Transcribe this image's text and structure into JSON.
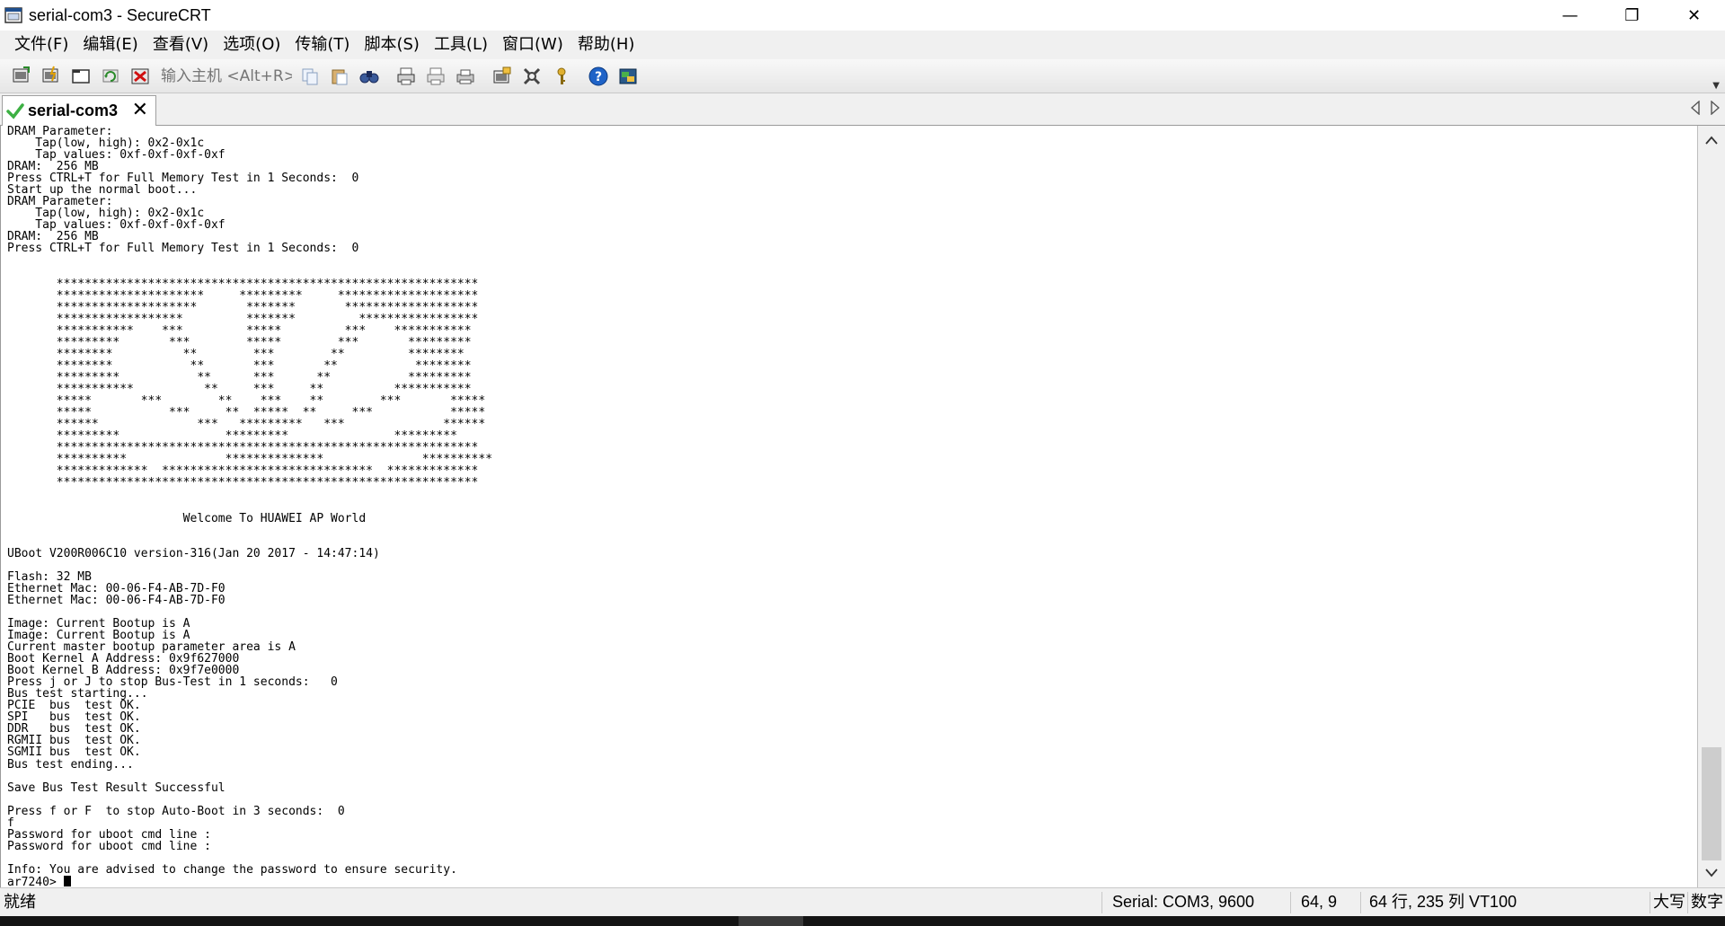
{
  "window": {
    "title": "serial-com3 - SecureCRT",
    "minimize_glyph": "—",
    "restore_glyph": "❐",
    "close_glyph": "✕"
  },
  "menu": [
    "文件(F)",
    "编辑(E)",
    "查看(V)",
    "选项(O)",
    "传输(T)",
    "脚本(S)",
    "工具(L)",
    "窗口(W)",
    "帮助(H)"
  ],
  "toolbar": {
    "quick_connect_placeholder": "输入主机 <Alt+R>",
    "icons": [
      "connect-icon",
      "quick-connect-icon",
      "connect-in-tab-icon",
      "reconnect-icon",
      "disconnect-icon",
      "copy-icon",
      "paste-icon",
      "find-icon",
      "print-screen-icon",
      "print-selection-icon",
      "print-icon",
      "session-options-icon",
      "global-options-icon",
      "keymap-icon",
      "help-icon",
      "sftp-icon"
    ]
  },
  "tab": {
    "label": "serial-com3",
    "close_glyph": "✕"
  },
  "terminal": {
    "lines": [
      "DRAM Parameter:",
      "    Tap(low, high): 0x2-0x1c",
      "    Tap values: 0xf-0xf-0xf-0xf",
      "DRAM:  256 MB",
      "Press CTRL+T for Full Memory Test in 1 Seconds:  0",
      "Start up the normal boot...",
      "DRAM Parameter:",
      "    Tap(low, high): 0x2-0x1c",
      "    Tap values: 0xf-0xf-0xf-0xf",
      "DRAM:  256 MB",
      "Press CTRL+T for Full Memory Test in 1 Seconds:  0",
      "",
      "",
      "       ************************************************************",
      "       *********************     *********     ********************",
      "       ********************       *******       *******************",
      "       ******************         *******         *****************",
      "       ***********    ***         *****         ***    ***********",
      "       *********       ***        *****        ***       *********",
      "       ********          **        ***        **         ********",
      "       ********           **       ***       **           ********",
      "       *********           **      ***      **           *********",
      "       ***********          **     ***     **          ***********",
      "       *****       ***        **    ***    **        ***       *****",
      "       *****           ***     **  *****  **     ***           *****",
      "       ******              ***   *********   ***              ******",
      "       *********               *********               *********",
      "       ************************************************************",
      "       **********              **************              **********",
      "       *************  ******************************  *************",
      "       ************************************************************",
      "",
      "",
      "                         Welcome To HUAWEI AP World",
      "",
      "",
      "UBoot V200R006C10 version-316(Jan 20 2017 - 14:47:14)",
      "",
      "Flash: 32 MB",
      "Ethernet Mac: 00-06-F4-AB-7D-F0",
      "Ethernet Mac: 00-06-F4-AB-7D-F0",
      "",
      "Image: Current Bootup is A",
      "Image: Current Bootup is A",
      "Current master bootup parameter area is A",
      "Boot Kernel A Address: 0x9f627000",
      "Boot Kernel B Address: 0x9f7e0000",
      "Press j or J to stop Bus-Test in 1 seconds:   0",
      "Bus test starting...",
      "PCIE  bus  test OK.",
      "SPI   bus  test OK.",
      "DDR   bus  test OK.",
      "RGMII bus  test OK.",
      "SGMII bus  test OK.",
      "Bus test ending...",
      "",
      "Save Bus Test Result Successful",
      "",
      "Press f or F  to stop Auto-Boot in 3 seconds:  0",
      "f",
      "Password for uboot cmd line :",
      "Password for uboot cmd line :",
      "",
      "Info: You are advised to change the password to ensure security."
    ],
    "prompt": "ar7240> "
  },
  "statusbar": {
    "ready": "就绪",
    "connection": "Serial: COM3, 9600",
    "cursor_pos": "64,   9",
    "dimensions": "64 行, 235 列 VT100",
    "caps": "大写",
    "num": "数字"
  },
  "colors": {
    "menubar_bg": "#f0f0f0",
    "terminal_bg": "#ffffff",
    "terminal_fg": "#000000",
    "tab_check": "#3cb043",
    "help_blue": "#1f63c7"
  }
}
